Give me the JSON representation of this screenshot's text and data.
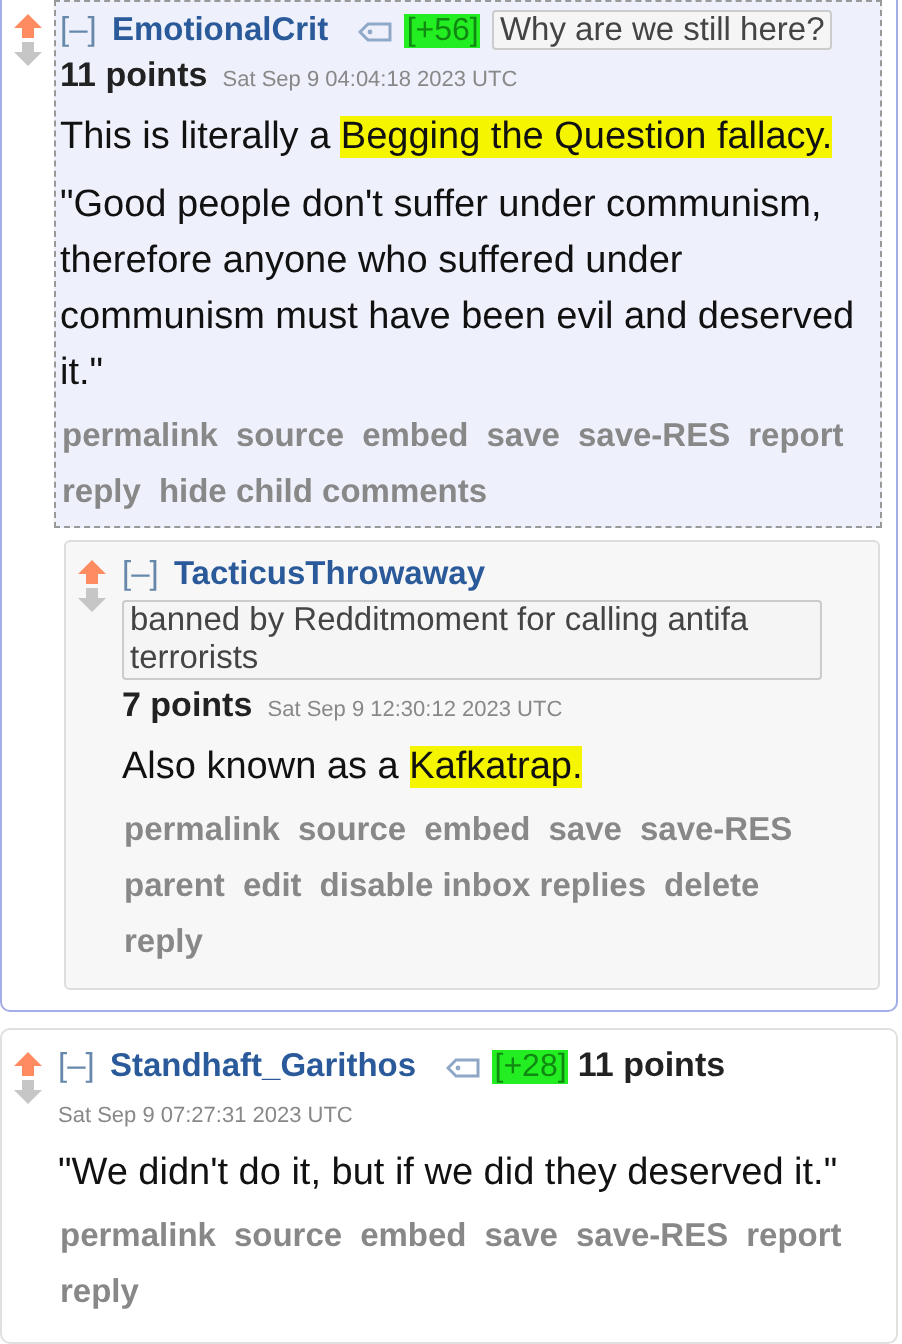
{
  "comments": [
    {
      "toggle": "[–]",
      "author": "EmotionalCrit",
      "highlighted": true,
      "karma": "[+56]",
      "flair": "Why are we still here?",
      "points": "11 points",
      "time": "Sat Sep 9 04:04:18 2023 UTC",
      "paragraphs": [
        [
          {
            "text": "This is literally a ",
            "highlighted": false
          },
          {
            "text": "Begging the Question fallacy.",
            "highlighted": true
          }
        ],
        [
          {
            "text": "\"Good people don't suffer under communism, therefore anyone who suffered under communism must have been evil and deserved it.\"",
            "highlighted": false
          }
        ]
      ],
      "links": [
        "permalink",
        "source",
        "embed",
        "save",
        "save-RES",
        "report",
        "reply",
        "hide child comments"
      ],
      "children": [
        {
          "toggle": "[–]",
          "author": "TacticusThrowaway",
          "highlighted": false,
          "flair": "banned by Redditmoment for calling antifa terrorists",
          "points": "7 points",
          "time": "Sat Sep 9 12:30:12 2023 UTC",
          "paragraphs": [
            [
              {
                "text": "Also known as a ",
                "highlighted": false
              },
              {
                "text": "Kafkatrap.",
                "highlighted": true
              }
            ]
          ],
          "links": [
            "permalink",
            "source",
            "embed",
            "save",
            "save-RES",
            "parent",
            "edit",
            "disable inbox replies",
            "delete",
            "reply"
          ]
        }
      ]
    },
    {
      "toggle": "[–]",
      "author": "Standhaft_Garithos",
      "highlighted": false,
      "karma": "[+28]",
      "points": "11 points",
      "time": "Sat Sep 9 07:27:31 2023 UTC",
      "paragraphs": [
        [
          {
            "text": "\"We didn't do it, but if we did they deserved it.\"",
            "highlighted": false
          }
        ]
      ],
      "links": [
        "permalink",
        "source",
        "embed",
        "save",
        "save-RES",
        "report",
        "reply"
      ]
    }
  ]
}
